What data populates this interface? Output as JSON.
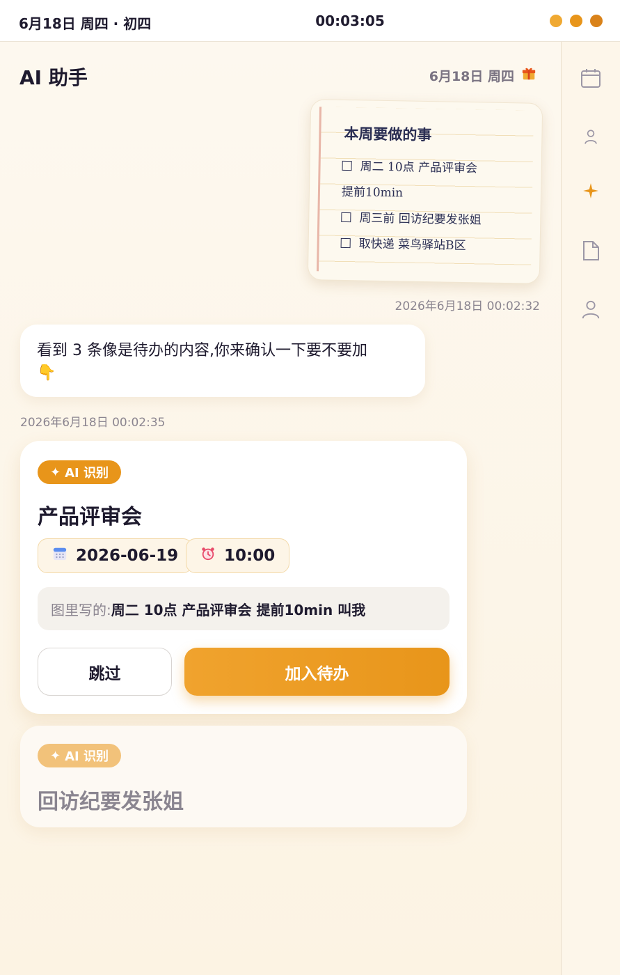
{
  "status_bar": {
    "date": "6月18日 周四 · 初四",
    "time": "00:03:05",
    "dot_colors": [
      "#f0a932",
      "#e8951a",
      "#d9821a"
    ]
  },
  "header": {
    "title": "AI 助手",
    "date": "6月18日 周四",
    "gift_icon": "gift-icon"
  },
  "sidebar": {
    "icons": [
      "calendar-icon",
      "user-icon",
      "sparkle-icon",
      "document-icon",
      "profile-icon"
    ],
    "active_color": "#e8951a"
  },
  "note": {
    "title": "本周要做的事",
    "line1": "周二 10点 产品评审会",
    "line2": "提前10min",
    "line3": "周三前 回访纪要发张姐",
    "line4": "取快递 菜鸟驿站B区"
  },
  "messages": {
    "image_timestamp": "2026年6月18日 00:02:32",
    "assistant_text": "看到 3 条像是待办的内容,你来确认一下要不要加",
    "assistant_emoji": "👇",
    "assistant_timestamp": "2026年6月18日 00:02:35"
  },
  "cards": [
    {
      "tag": "AI 识别",
      "title": "产品评审会",
      "date": "2026-06-19",
      "time": "10:00",
      "source_label": "图里写的: ",
      "source_value": "周二 10点 产品评审会 提前10min 叫我",
      "skip_label": "跳过",
      "add_label": "加入待办"
    },
    {
      "tag": "AI 识别",
      "title": "回访纪要发张姐"
    }
  ],
  "colors": {
    "accent": "#e8951a",
    "text": "#1e1a2e",
    "muted": "#8b8590"
  }
}
